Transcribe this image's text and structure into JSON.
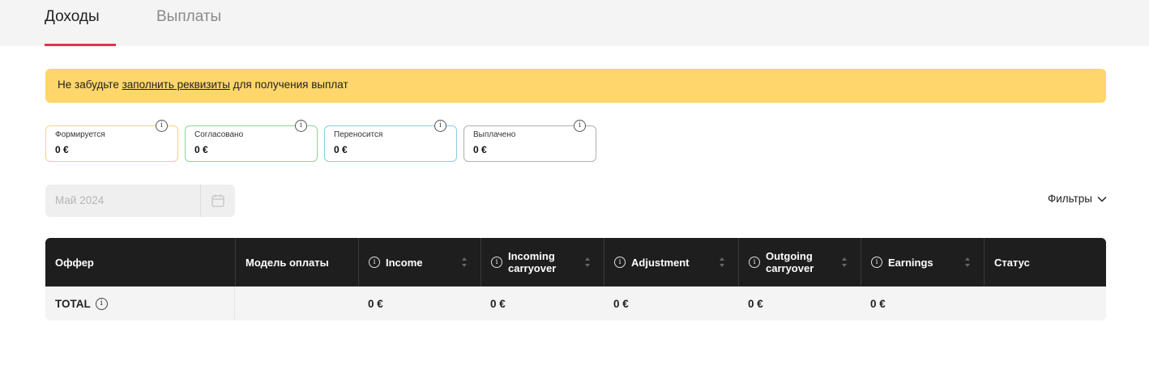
{
  "tabs": [
    {
      "label": "Доходы",
      "active": true
    },
    {
      "label": "Выплаты",
      "active": false
    }
  ],
  "notice": {
    "prefix": "Не забудьте ",
    "link": "заполнить реквизиты",
    "suffix": " для получения выплат",
    "bg_color": "#ffd66b"
  },
  "stats": [
    {
      "label": "Формируется",
      "value": "0 €",
      "border_color": "#f5d57a"
    },
    {
      "label": "Согласовано",
      "value": "0 €",
      "border_color": "#8fd49a"
    },
    {
      "label": "Переносится",
      "value": "0 €",
      "border_color": "#8ccbe6"
    },
    {
      "label": "Выплачено",
      "value": "0 €",
      "border_color": "#b0b0b0"
    }
  ],
  "date_picker": {
    "value": "Май 2024",
    "icon": "calendar-icon"
  },
  "filters": {
    "label": "Фильтры",
    "icon": "chevron-down-icon"
  },
  "table": {
    "columns": [
      {
        "label": "Оффер",
        "info": false,
        "sortable": false
      },
      {
        "label": "Модель оплаты",
        "info": false,
        "sortable": false
      },
      {
        "label": "Income",
        "info": true,
        "sortable": true
      },
      {
        "label_line1": "Incoming",
        "label_line2": "carryover",
        "info": true,
        "sortable": true
      },
      {
        "label": "Adjustment",
        "info": true,
        "sortable": true
      },
      {
        "label_line1": "Outgoing",
        "label_line2": "carryover",
        "info": true,
        "sortable": true
      },
      {
        "label": "Earnings",
        "info": true,
        "sortable": true
      },
      {
        "label": "Статус",
        "info": false,
        "sortable": false
      }
    ],
    "total_row": {
      "label": "TOTAL",
      "income": "0 €",
      "incoming_carryover": "0 €",
      "adjustment": "0 €",
      "outgoing_carryover": "0 €",
      "earnings": "0 €"
    }
  },
  "colors": {
    "accent": "#e0334f",
    "header_bg": "#1e1e1e"
  }
}
